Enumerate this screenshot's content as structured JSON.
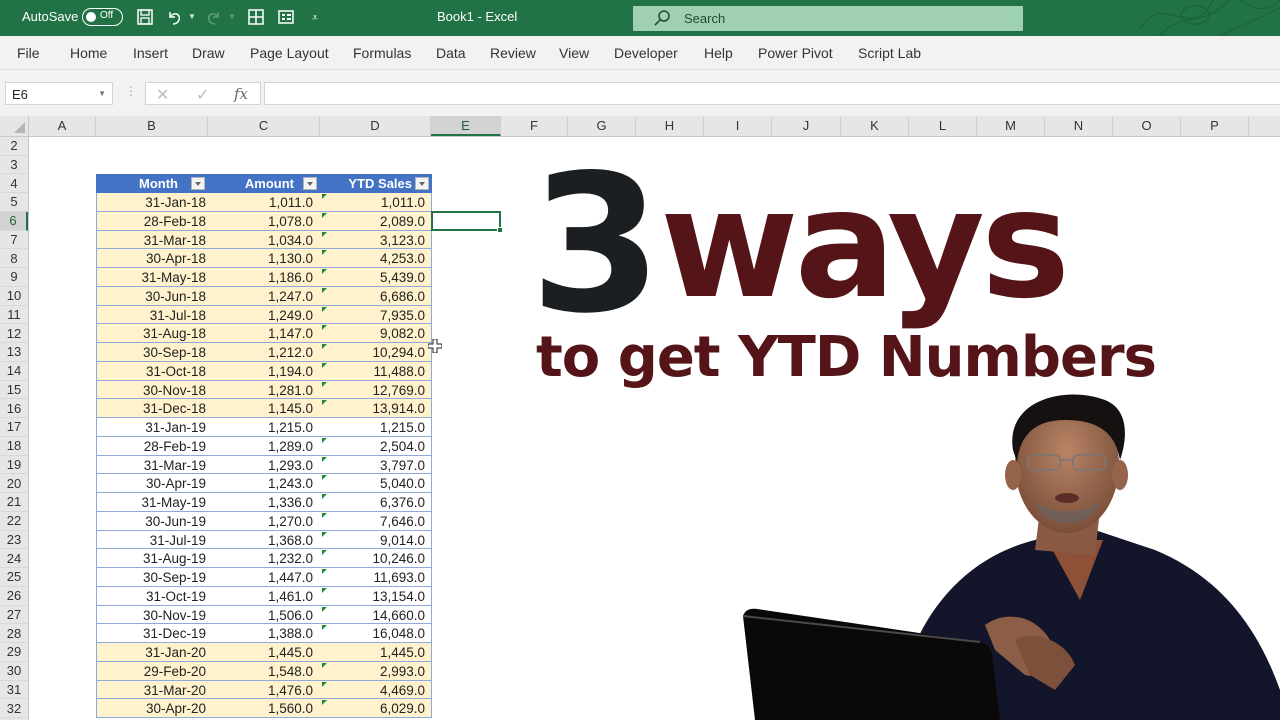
{
  "titlebar": {
    "autosave_label": "AutoSave",
    "autosave_state": "Off",
    "document_title": "Book1  -  Excel",
    "search_placeholder": "Search",
    "quick_access": [
      "save-icon",
      "undo-icon",
      "redo-icon",
      "borders-icon",
      "form-icon",
      "customize-icon"
    ]
  },
  "ribbon": {
    "tabs": [
      "File",
      "Home",
      "Insert",
      "Draw",
      "Page Layout",
      "Formulas",
      "Data",
      "Review",
      "View",
      "Developer",
      "Help",
      "Power Pivot",
      "Script Lab"
    ]
  },
  "formula_bar": {
    "name_box": "E6",
    "cancel_icon": "✕",
    "enter_icon": "✓",
    "fx_label": "fx",
    "formula": ""
  },
  "columns": [
    "A",
    "B",
    "C",
    "D",
    "E",
    "F",
    "G",
    "H",
    "I",
    "J",
    "K",
    "L",
    "M",
    "N",
    "O",
    "P"
  ],
  "selected_column": "E",
  "rows": [
    "2",
    "3",
    "4",
    "5",
    "6",
    "7",
    "8",
    "9",
    "10",
    "11",
    "12",
    "13",
    "14",
    "15",
    "16",
    "17",
    "18",
    "19",
    "20",
    "21",
    "22",
    "23",
    "24",
    "25",
    "26",
    "27",
    "28",
    "29",
    "30",
    "31",
    "32"
  ],
  "selected_row": "6",
  "table": {
    "headers": [
      "Month",
      "Amount",
      "YTD Sales"
    ],
    "header_color": "#4472c4",
    "band_color": "#fff2cc",
    "rows": [
      {
        "month": "31-Jan-18",
        "amount": "1,011.0",
        "ytd": "1,011.0",
        "band": true,
        "flag": true
      },
      {
        "month": "28-Feb-18",
        "amount": "1,078.0",
        "ytd": "2,089.0",
        "band": true,
        "flag": true
      },
      {
        "month": "31-Mar-18",
        "amount": "1,034.0",
        "ytd": "3,123.0",
        "band": true,
        "flag": true
      },
      {
        "month": "30-Apr-18",
        "amount": "1,130.0",
        "ytd": "4,253.0",
        "band": true,
        "flag": true
      },
      {
        "month": "31-May-18",
        "amount": "1,186.0",
        "ytd": "5,439.0",
        "band": true,
        "flag": true
      },
      {
        "month": "30-Jun-18",
        "amount": "1,247.0",
        "ytd": "6,686.0",
        "band": true,
        "flag": true
      },
      {
        "month": "31-Jul-18",
        "amount": "1,249.0",
        "ytd": "7,935.0",
        "band": true,
        "flag": true
      },
      {
        "month": "31-Aug-18",
        "amount": "1,147.0",
        "ytd": "9,082.0",
        "band": true,
        "flag": true
      },
      {
        "month": "30-Sep-18",
        "amount": "1,212.0",
        "ytd": "10,294.0",
        "band": true,
        "flag": true
      },
      {
        "month": "31-Oct-18",
        "amount": "1,194.0",
        "ytd": "11,488.0",
        "band": true,
        "flag": true
      },
      {
        "month": "30-Nov-18",
        "amount": "1,281.0",
        "ytd": "12,769.0",
        "band": true,
        "flag": true
      },
      {
        "month": "31-Dec-18",
        "amount": "1,145.0",
        "ytd": "13,914.0",
        "band": true,
        "flag": true
      },
      {
        "month": "31-Jan-19",
        "amount": "1,215.0",
        "ytd": "1,215.0",
        "band": false,
        "flag": false
      },
      {
        "month": "28-Feb-19",
        "amount": "1,289.0",
        "ytd": "2,504.0",
        "band": false,
        "flag": true
      },
      {
        "month": "31-Mar-19",
        "amount": "1,293.0",
        "ytd": "3,797.0",
        "band": false,
        "flag": true
      },
      {
        "month": "30-Apr-19",
        "amount": "1,243.0",
        "ytd": "5,040.0",
        "band": false,
        "flag": true
      },
      {
        "month": "31-May-19",
        "amount": "1,336.0",
        "ytd": "6,376.0",
        "band": false,
        "flag": true
      },
      {
        "month": "30-Jun-19",
        "amount": "1,270.0",
        "ytd": "7,646.0",
        "band": false,
        "flag": true
      },
      {
        "month": "31-Jul-19",
        "amount": "1,368.0",
        "ytd": "9,014.0",
        "band": false,
        "flag": true
      },
      {
        "month": "31-Aug-19",
        "amount": "1,232.0",
        "ytd": "10,246.0",
        "band": false,
        "flag": true
      },
      {
        "month": "30-Sep-19",
        "amount": "1,447.0",
        "ytd": "11,693.0",
        "band": false,
        "flag": true
      },
      {
        "month": "31-Oct-19",
        "amount": "1,461.0",
        "ytd": "13,154.0",
        "band": false,
        "flag": true
      },
      {
        "month": "30-Nov-19",
        "amount": "1,506.0",
        "ytd": "14,660.0",
        "band": false,
        "flag": true
      },
      {
        "month": "31-Dec-19",
        "amount": "1,388.0",
        "ytd": "16,048.0",
        "band": false,
        "flag": true
      },
      {
        "month": "31-Jan-20",
        "amount": "1,445.0",
        "ytd": "1,445.0",
        "band": true,
        "flag": false
      },
      {
        "month": "29-Feb-20",
        "amount": "1,548.0",
        "ytd": "2,993.0",
        "band": true,
        "flag": true
      },
      {
        "month": "31-Mar-20",
        "amount": "1,476.0",
        "ytd": "4,469.0",
        "band": true,
        "flag": true
      },
      {
        "month": "30-Apr-20",
        "amount": "1,560.0",
        "ytd": "6,029.0",
        "band": true,
        "flag": true
      }
    ]
  },
  "overlay": {
    "number": "3",
    "headline": "ways",
    "subtitle": "to get YTD Numbers",
    "number_color": "#1c1f22",
    "text_color": "#541418"
  },
  "colors": {
    "excel_green": "#217346",
    "search_bg": "#a0d0b2",
    "ribbon_bg": "#f3f2f1"
  }
}
